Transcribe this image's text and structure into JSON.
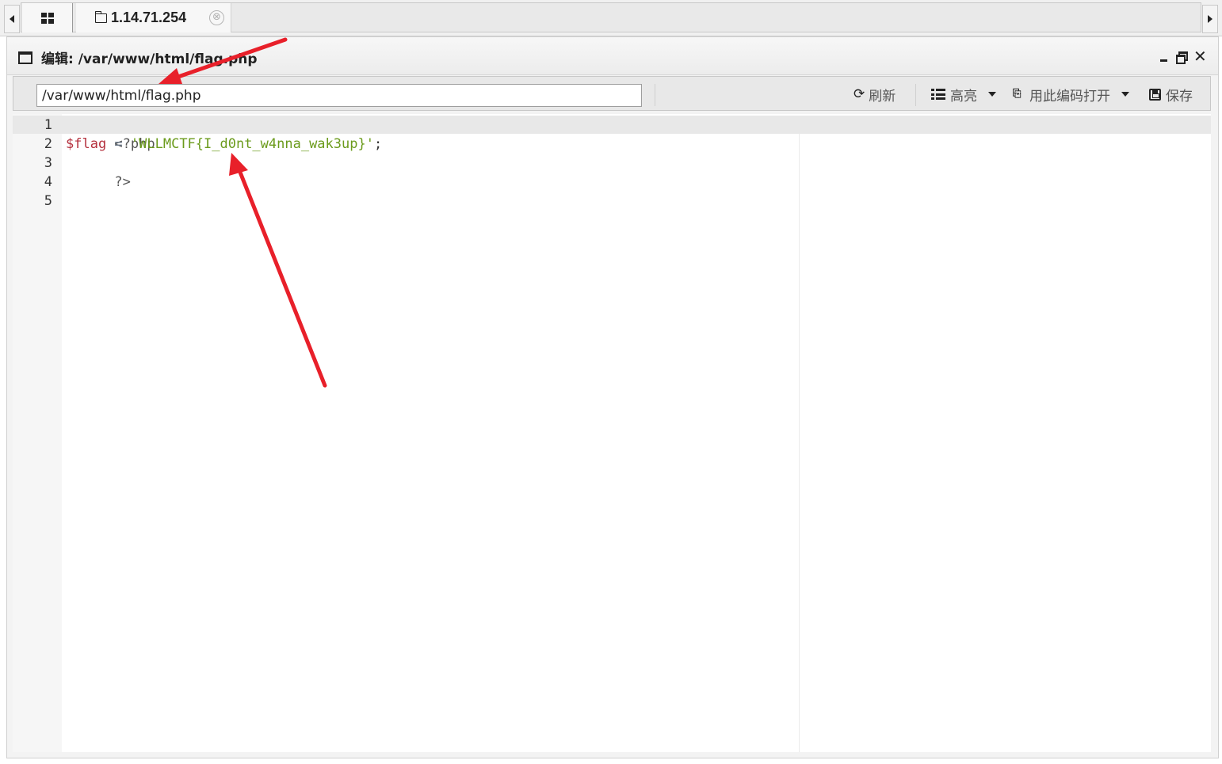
{
  "tabbar": {
    "host_tab_title": "1.14.71.254",
    "close_glyph": "⊗"
  },
  "window": {
    "title": "编辑: /var/www/html/flag.php",
    "close_glyph": "✕"
  },
  "toolbar": {
    "path_value": "/var/www/html/flag.php",
    "refresh_label": "刷新",
    "highlight_label": "高亮",
    "encoding_label": "用此编码打开",
    "save_label": "保存"
  },
  "editor": {
    "line_numbers": [
      "1",
      "2",
      "3",
      "4",
      "5"
    ],
    "lines": {
      "l1": "<?php",
      "l2_var": "$flag",
      "l2_op": " = ",
      "l2_str": "'WLLMCTF{I_d0nt_w4nna_wak3up}'",
      "l2_end": ";",
      "l3": "?>"
    },
    "colors": {
      "variable": "#b5313e",
      "string": "#6b9b1c",
      "operator": "#687687"
    }
  },
  "annotations": {
    "arrow_color": "#e8202a"
  }
}
